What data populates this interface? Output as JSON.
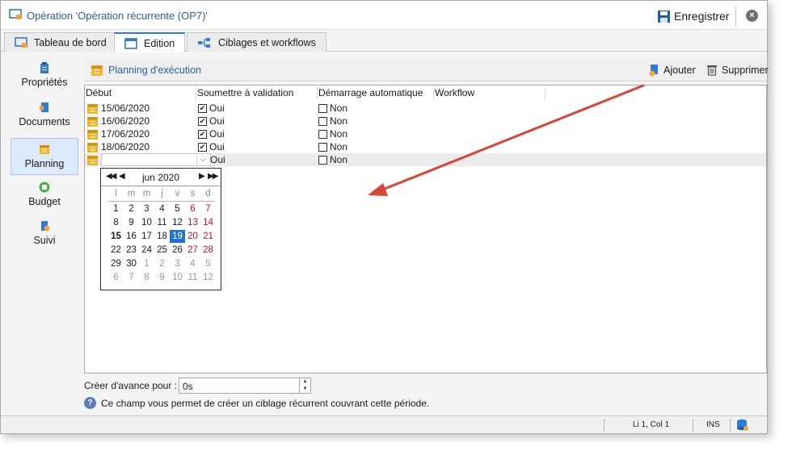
{
  "window": {
    "title": "Opération 'Opération récurrente (OP7)'",
    "save_label": "Enregistrer",
    "close_glyph": "×"
  },
  "tabs": [
    {
      "label": "Tableau de bord",
      "icon": "dashboard-icon"
    },
    {
      "label": "Edition",
      "icon": "window-icon",
      "active": true
    },
    {
      "label": "Ciblages et workflows",
      "icon": "workflow-icon"
    }
  ],
  "sidebar": {
    "items": [
      {
        "label": "Propriétés",
        "icon": "clipboard-icon"
      },
      {
        "label": "Documents",
        "icon": "documents-icon"
      },
      {
        "label": "Planning",
        "icon": "calendar-icon",
        "active": true
      },
      {
        "label": "Budget",
        "icon": "calculator-icon"
      },
      {
        "label": "Suivi",
        "icon": "tracking-icon"
      }
    ]
  },
  "section": {
    "title": "Planning d'exécution",
    "add_label": "Ajouter",
    "delete_label": "Supprimer"
  },
  "grid": {
    "headers": [
      "Début",
      "Soumettre à validation",
      "Démarrage automatique",
      "Workflow"
    ],
    "rows": [
      {
        "date": "15/06/2020",
        "validation": "Oui",
        "validation_checked": true,
        "auto": "Non",
        "auto_checked": false
      },
      {
        "date": "16/06/2020",
        "validation": "Oui",
        "validation_checked": true,
        "auto": "Non",
        "auto_checked": false
      },
      {
        "date": "17/06/2020",
        "validation": "Oui",
        "validation_checked": true,
        "auto": "Non",
        "auto_checked": false
      },
      {
        "date": "18/06/2020",
        "validation": "Oui",
        "validation_checked": true,
        "auto": "Non",
        "auto_checked": false
      }
    ],
    "new_row": {
      "date": "",
      "validation": "Oui",
      "auto": "Non"
    }
  },
  "calendar": {
    "month": "jun 2020",
    "prev_year": "◀◀",
    "prev_month": "◀",
    "next_month": "▶",
    "next_year": "▶▶",
    "weekdays": [
      "l",
      "m",
      "m",
      "j",
      "v",
      "s",
      "d"
    ],
    "weeks": [
      [
        "1",
        "2",
        "3",
        "4",
        "5",
        "6",
        "7"
      ],
      [
        "8",
        "9",
        "10",
        "11",
        "12",
        "13",
        "14"
      ],
      [
        "15",
        "16",
        "17",
        "18",
        "19",
        "20",
        "21"
      ],
      [
        "22",
        "23",
        "24",
        "25",
        "26",
        "27",
        "28"
      ],
      [
        "29",
        "30",
        "1",
        "2",
        "3",
        "4",
        "5"
      ],
      [
        "6",
        "7",
        "8",
        "9",
        "10",
        "11",
        "12"
      ]
    ],
    "today": "15",
    "selected": "19"
  },
  "footer": {
    "advance_label": "Créer d'avance pour :",
    "advance_value": "0s",
    "help_text": "Ce champ vous permet de créer un ciblage récurrent couvrant cette période."
  },
  "status": {
    "position": "Li 1, Col 1",
    "mode": "INS"
  },
  "colors": {
    "accent": "#2f7bd6",
    "title_text": "#2b5fa0",
    "weekend": "#c8102e",
    "selected_day": "#1f73d0",
    "arrow": "#d9443a"
  }
}
